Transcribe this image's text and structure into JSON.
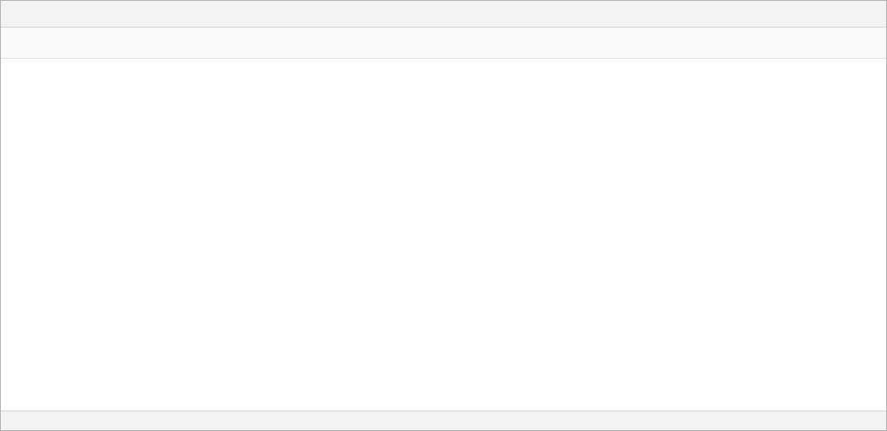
{
  "window": {
    "title": ""
  },
  "status": {
    "text": ""
  }
}
